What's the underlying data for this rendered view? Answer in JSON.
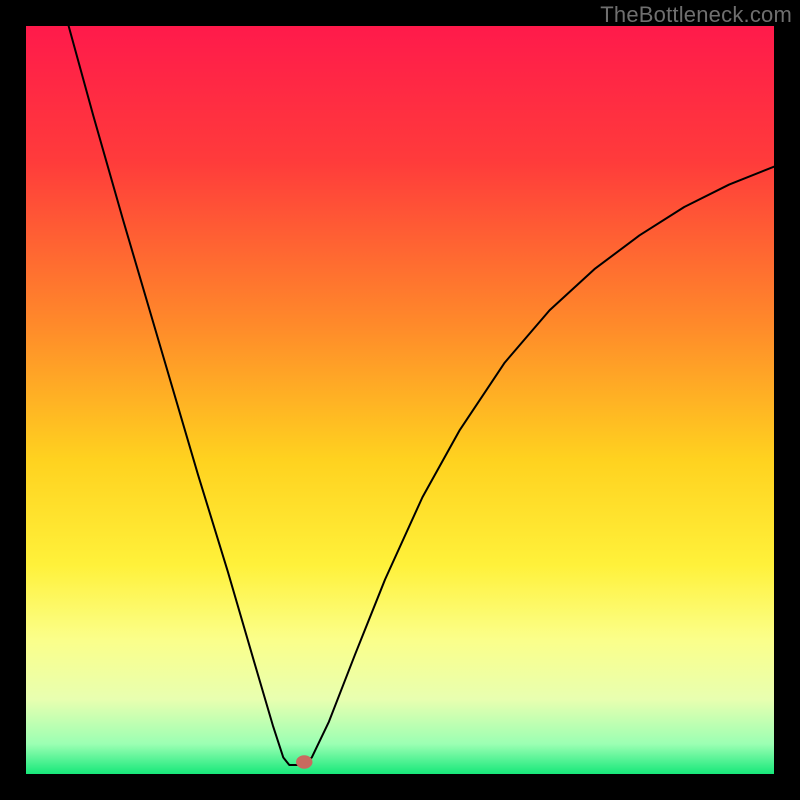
{
  "watermark": "TheBottleneck.com",
  "chart_data": {
    "type": "line",
    "title": "",
    "xlabel": "",
    "ylabel": "",
    "xlim": [
      0,
      100
    ],
    "ylim": [
      0,
      100
    ],
    "gradient_stops": [
      {
        "offset": 0,
        "color": "#ff1a4b"
      },
      {
        "offset": 18,
        "color": "#ff3b3b"
      },
      {
        "offset": 40,
        "color": "#ff8a2a"
      },
      {
        "offset": 58,
        "color": "#ffd21f"
      },
      {
        "offset": 72,
        "color": "#fff13a"
      },
      {
        "offset": 82,
        "color": "#fbff8a"
      },
      {
        "offset": 90,
        "color": "#e8ffb0"
      },
      {
        "offset": 96,
        "color": "#9bffb3"
      },
      {
        "offset": 100,
        "color": "#17e87a"
      }
    ],
    "series": [
      {
        "name": "bottleneck-curve",
        "type": "line",
        "points": [
          {
            "x": 5.7,
            "y": 100.0
          },
          {
            "x": 9.0,
            "y": 88.0
          },
          {
            "x": 13.0,
            "y": 74.0
          },
          {
            "x": 18.0,
            "y": 57.0
          },
          {
            "x": 23.0,
            "y": 40.0
          },
          {
            "x": 27.0,
            "y": 27.0
          },
          {
            "x": 30.5,
            "y": 15.0
          },
          {
            "x": 33.0,
            "y": 6.5
          },
          {
            "x": 34.4,
            "y": 2.2
          },
          {
            "x": 35.2,
            "y": 1.2
          },
          {
            "x": 37.0,
            "y": 1.2
          },
          {
            "x": 38.2,
            "y": 2.2
          },
          {
            "x": 40.5,
            "y": 7.0
          },
          {
            "x": 44.0,
            "y": 16.0
          },
          {
            "x": 48.0,
            "y": 26.0
          },
          {
            "x": 53.0,
            "y": 37.0
          },
          {
            "x": 58.0,
            "y": 46.0
          },
          {
            "x": 64.0,
            "y": 55.0
          },
          {
            "x": 70.0,
            "y": 62.0
          },
          {
            "x": 76.0,
            "y": 67.5
          },
          {
            "x": 82.0,
            "y": 72.0
          },
          {
            "x": 88.0,
            "y": 75.8
          },
          {
            "x": 94.0,
            "y": 78.8
          },
          {
            "x": 100.0,
            "y": 81.2
          }
        ]
      }
    ],
    "marker": {
      "x": 37.2,
      "y": 1.6,
      "rx": 1.1,
      "ry": 0.9,
      "color": "#c96a5f"
    }
  }
}
